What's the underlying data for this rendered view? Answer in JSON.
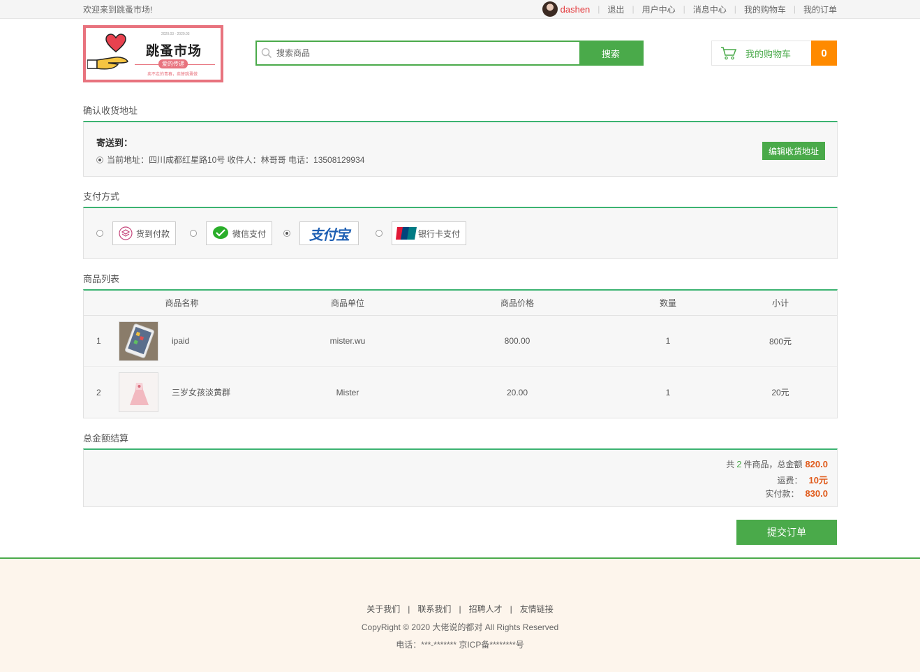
{
  "topbar": {
    "welcome": "欢迎来到跳蚤市场!",
    "username": "dashen",
    "links": [
      "退出",
      "用户中心",
      "消息中心",
      "我的购物车",
      "我的订单"
    ]
  },
  "logo": {
    "title": "跳蚤市场",
    "subtitle": "爱的传递",
    "tagline": "卖不走的青春，卖替跳蚤做",
    "top": "2020.03 · 2020.03"
  },
  "search": {
    "placeholder": "搜索商品",
    "button": "搜索"
  },
  "cart": {
    "label": "我的购物车",
    "count": "0"
  },
  "address": {
    "section_title": "确认收货地址",
    "heading": "寄送到：",
    "current": "当前地址：四川成都红星路10号 收件人：林哥哥 电话：13508129934",
    "edit_button": "编辑收货地址"
  },
  "payment": {
    "section_title": "支付方式",
    "options": [
      {
        "label": "货到付款",
        "icon": "cash-on-delivery-icon",
        "selected": false
      },
      {
        "label": "微信支付",
        "icon": "wechat-pay-icon",
        "selected": false
      },
      {
        "label": "支付宝",
        "icon": "alipay-logo",
        "selected": true
      },
      {
        "label": "银行卡支付",
        "icon": "unionpay-icon",
        "selected": false
      }
    ]
  },
  "items": {
    "section_title": "商品列表",
    "headers": [
      "商品名称",
      "商品单位",
      "商品价格",
      "数量",
      "小计"
    ],
    "rows": [
      {
        "index": "1",
        "name": "ipaid",
        "unit": "mister.wu",
        "price": "800.00",
        "qty": "1",
        "subtotal": "800元"
      },
      {
        "index": "2",
        "name": "三岁女孩淡黄群",
        "unit": "Mister",
        "price": "20.00",
        "qty": "1",
        "subtotal": "20元"
      }
    ]
  },
  "total": {
    "section_title": "总金额结算",
    "count_prefix": "共",
    "count": "2",
    "count_suffix": "件商品，总金额",
    "amount": "820.0",
    "shipping_label": "运费：",
    "shipping": "10元",
    "pay_label": "实付款：",
    "pay": "830.0"
  },
  "submit_button": "提交订单",
  "footer": {
    "links": [
      "关于我们",
      "联系我们",
      "招聘人才",
      "友情链接"
    ],
    "copyright": "CopyRight © 2020 大佬说的都对 All Rights Reserved",
    "phone": "电话：***-******* 京ICP备********号"
  },
  "colors": {
    "accent": "#4aaa4a",
    "divider": "#3cb371",
    "cart_badge": "#ff8a00",
    "price": "#e05a1a",
    "footer_bg": "#fdf5ec"
  }
}
